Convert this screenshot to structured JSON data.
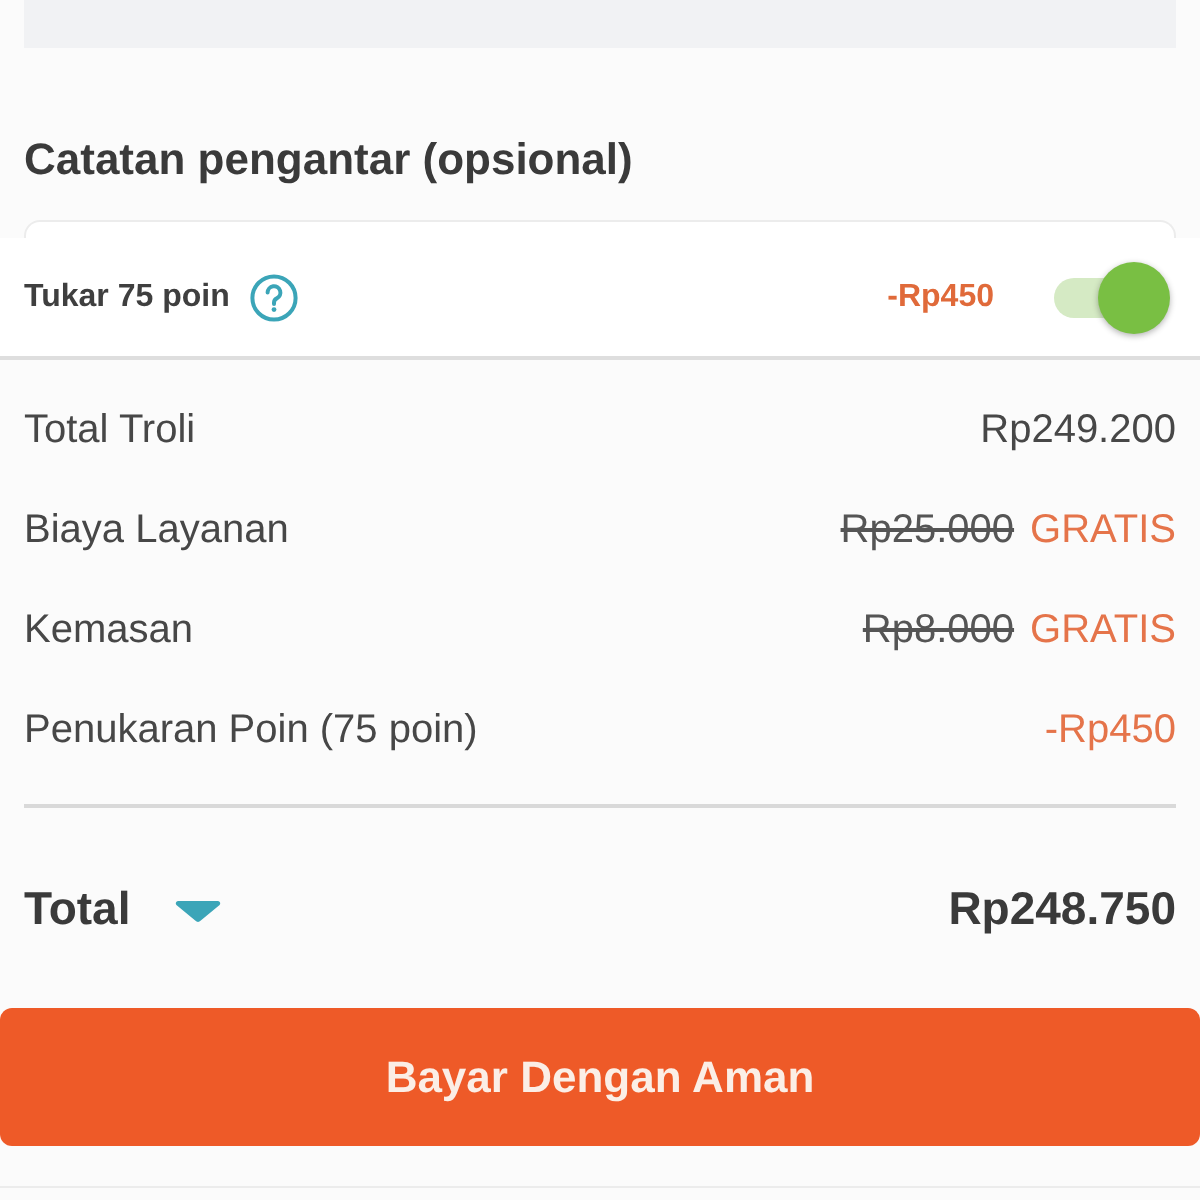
{
  "note_section": {
    "title": "Catatan pengantar (opsional)"
  },
  "points_redeem": {
    "label": "Tukar 75 poin",
    "discount": "-Rp450",
    "on": true
  },
  "summary": [
    {
      "kind": "normal",
      "label": "Total Troli",
      "value": "Rp249.200"
    },
    {
      "kind": "free",
      "label": "Biaya Layanan",
      "original": "Rp25.000",
      "value": "GRATIS"
    },
    {
      "kind": "free",
      "label": "Kemasan",
      "original": "Rp8.000",
      "value": "GRATIS"
    },
    {
      "kind": "discount",
      "label": "Penukaran Poin (75 poin)",
      "value": "-Rp450"
    }
  ],
  "total": {
    "label": "Total",
    "value": "Rp248.750"
  },
  "pay_button": {
    "label": "Bayar Dengan Aman"
  }
}
